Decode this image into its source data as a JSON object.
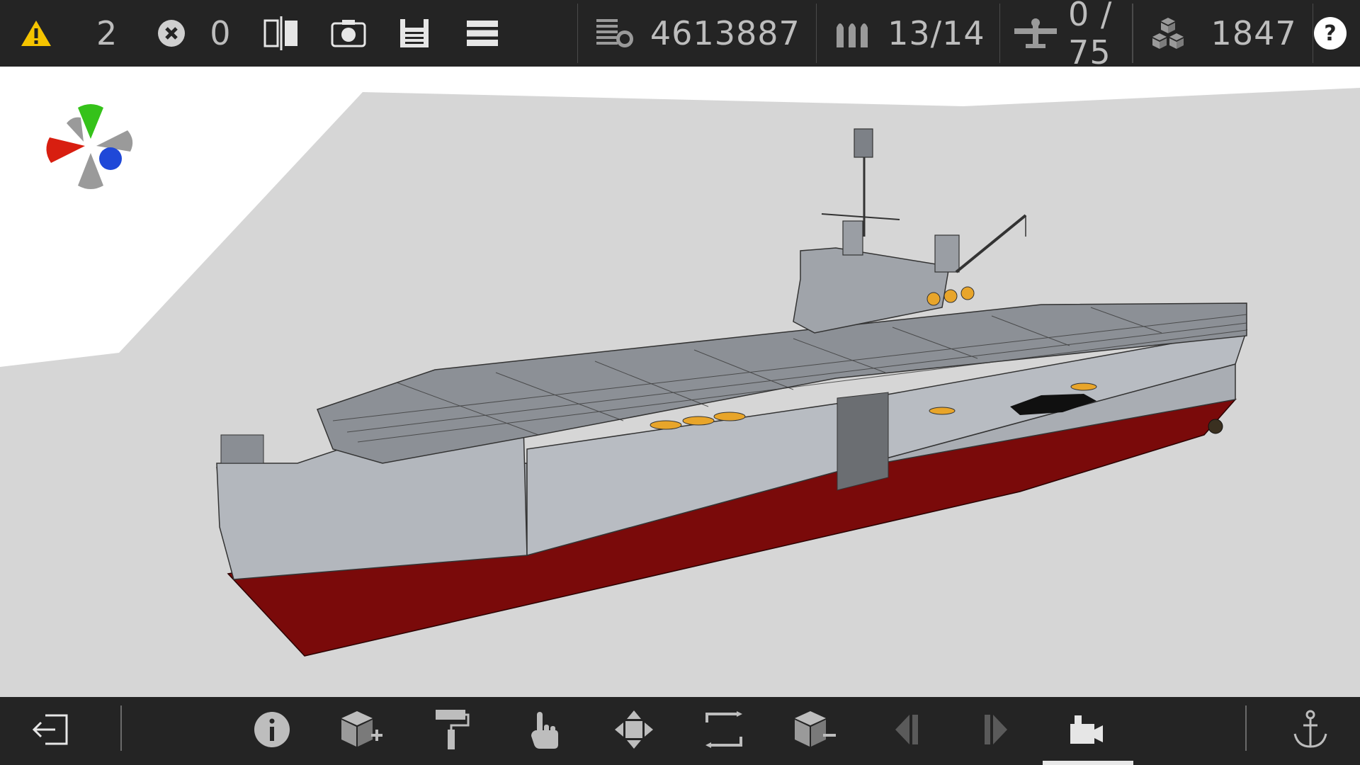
{
  "topbar": {
    "warnings": {
      "icon": "warning-icon",
      "count": "2",
      "color": "#f5c400"
    },
    "errors": {
      "icon": "error-x-icon",
      "count": "0"
    },
    "tools": [
      {
        "icon": "mirror-symmetry-icon"
      },
      {
        "icon": "camera-icon"
      },
      {
        "icon": "save-icon"
      },
      {
        "icon": "menu-icon"
      }
    ],
    "stats": [
      {
        "icon": "cost-coins-icon",
        "value": "4613887"
      },
      {
        "icon": "ammo-shells-icon",
        "value": "13/14"
      },
      {
        "icon": "aircraft-icon",
        "value": "0 / 75"
      },
      {
        "icon": "blocks-icon",
        "value": "1847"
      }
    ],
    "help": {
      "icon": "help-icon",
      "label": "?"
    }
  },
  "viewport": {
    "background_color": "#ffffff",
    "ground_color": "#d6d6d6",
    "hull_gray": "#a9adb3",
    "hull_red": "#7a0a0a",
    "gizmo_colors": {
      "y": "#35c21a",
      "x": "#d81e10",
      "z": "#1f48d8",
      "neutral": "#9a9a9a"
    }
  },
  "bottombar": {
    "buttons": [
      {
        "icon": "exit-icon"
      },
      {
        "icon": "info-icon"
      },
      {
        "icon": "add-block-icon"
      },
      {
        "icon": "paint-roller-icon"
      },
      {
        "icon": "select-hand-icon"
      },
      {
        "icon": "move-arrows-icon"
      },
      {
        "icon": "rotate-icon"
      },
      {
        "icon": "remove-block-icon"
      },
      {
        "icon": "previous-icon"
      },
      {
        "icon": "next-icon"
      },
      {
        "icon": "view-camera-icon",
        "active": true
      },
      {
        "icon": "anchor-icon"
      }
    ]
  }
}
